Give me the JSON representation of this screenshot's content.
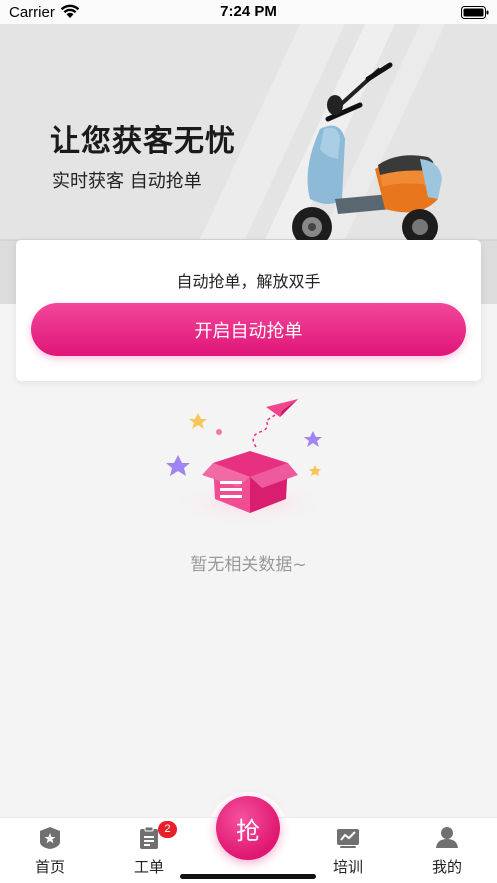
{
  "status_bar": {
    "carrier": "Carrier",
    "time": "7:24 PM",
    "icons": [
      "wifi-icon",
      "battery-icon"
    ]
  },
  "banner": {
    "headline": "让您获客无忧",
    "subtitle": "实时获客 自动抢单",
    "image": "electric-scooter"
  },
  "auto_grab_card": {
    "title": "自动抢单，解放双手",
    "button_label": "开启自动抢单"
  },
  "empty_state": {
    "illustration": "empty-box-icon",
    "text": "暂无相关数据~"
  },
  "tab_bar": {
    "center_button_label": "抢",
    "tabs": [
      {
        "label": "首页",
        "icon": "home-icon"
      },
      {
        "label": "工单",
        "icon": "work-order-icon",
        "badge": "2"
      },
      {
        "label": "培训",
        "icon": "training-icon"
      },
      {
        "label": "我的",
        "icon": "profile-icon"
      }
    ]
  },
  "colors": {
    "accent": "#e8207f",
    "badge": "#e8202a",
    "banner_bg": "#e4e4e4",
    "page_bg": "#f4f4f4"
  }
}
